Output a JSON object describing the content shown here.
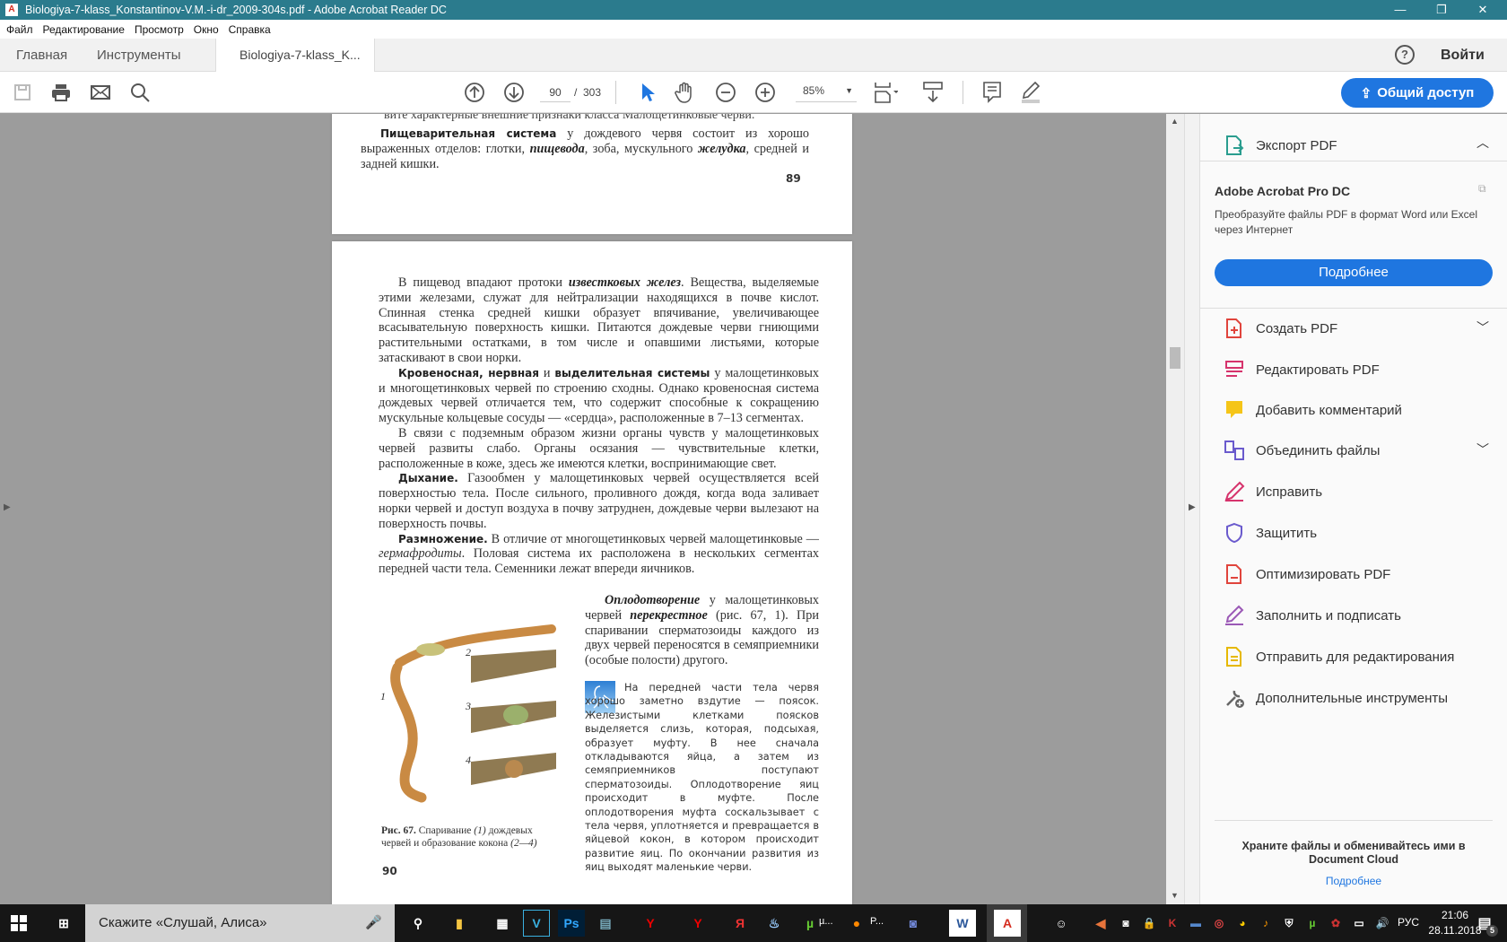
{
  "window": {
    "title": "Biologiya-7-klass_Konstantinov-V.M.-i-dr_2009-304s.pdf - Adobe Acrobat Reader DC",
    "minimize": "—",
    "maximize": "❐",
    "close": "✕"
  },
  "menu": [
    "Файл",
    "Редактирование",
    "Просмотр",
    "Окно",
    "Справка"
  ],
  "tabs": {
    "home": "Главная",
    "tools": "Инструменты",
    "doc": "Biologiya-7-klass_K...",
    "close": "×",
    "help": "?",
    "signin": "Войти"
  },
  "toolbar": {
    "page_current": "90",
    "page_sep": "/",
    "page_total": "303",
    "zoom": "85%",
    "share": "Общий доступ"
  },
  "page89": {
    "top_line": "вите характерные внешние признаки класса Малощетинковые черви.",
    "p1_bold": "Пищеварительная система",
    "p1_a": " у дождевого червя  состоит из хорошо выраженных отделов: глотки, ",
    "p1_b": "пищевода",
    "p1_c": ", зоба, мускульного ",
    "p1_d": "желудка",
    "p1_e": ", средней и задней кишки.",
    "number": "89"
  },
  "page90": {
    "p1_a": "В пищевод впадают протоки ",
    "p1_b": "известковых желез",
    "p1_c": ". Вещества, выделяемые этими железами, служат для нейтрализации находящихся в почве кислот. Спинная стенка средней кишки образует впячивание, увеличивающее всасывательную поверхность кишки. Питаются дождевые черви гниющими растительными остатками, в том числе и опавшими листьями, которые затаскивают в свои норки.",
    "p2_b1": "Кровеносная, нервная",
    "p2_a": " и ",
    "p2_b2": "выделительная системы",
    "p2_c": " у малощетинковых и многощетинковых червей по строению сходны. Однако кровеносная система дождевых червей отличается тем, что содержит способные к сокращению мускульные кольцевые сосуды — «сердца», расположенные в 7–13 сегментах.",
    "p3": "В связи с подземным образом жизни органы чувств у малощетинковых червей развиты слабо. Органы осязания — чувствительные клетки, расположенные в коже, здесь же имеются клетки, воспринимающие свет.",
    "p4_b": "Дыхание.",
    "p4_c": " Газообмен у малощетинковых червей осуществляется всей поверхностью тела. После сильного, проливного дождя, когда вода заливает норки червей и доступ воздуха в почву затруднен, дождевые черви вылезают на поверхность почвы.",
    "p5_b": "Размножение.",
    "p5_a": " В отличие от многощетинковых червей малощетинковые — ",
    "p5_i": "гермафродиты",
    "p5_c": ". Половая система их расположена в нескольких сегментах передней части тела. Семенники лежат впереди яичников.",
    "p6_b1": "Оплодотворение",
    "p6_a": " у малощетинковых червей ",
    "p6_b2": "перекрестное",
    "p6_c": " (рис. 67, 1). При спаривании сперматозоиды каждого из двух червей переносятся в семяприемники (особые полости) другого.",
    "box": "На передней части тела червя хорошо заметно вздутие — поясок. Железистыми клетками поясков выделяется слизь, которая, подсыхая, образует муфту. В нее сначала откладываются яйца, а затем из семяприемников поступают сперматозоиды. Оплодотворение яиц происходит в муфте. После оплодотворения муфта соскальзывает с тела червя, уплотняется и превращается в яйцевой кокон, в котором происходит развитие яиц. По окончании развития из яиц выходят маленькие черви.",
    "fig_labels": [
      "1",
      "2",
      "3",
      "4"
    ],
    "caption_b": "Рис. 67.",
    "caption_a": " Спаривание ",
    "caption_i1": "(1)",
    "caption_c": " дождевых червей и образование кокона ",
    "caption_i2": "(2—4)",
    "number": "90"
  },
  "panel": {
    "export": "Экспорт PDF",
    "product": "Adobe Acrobat Pro DC",
    "desc": "Преобразуйте файлы PDF в формат Word или Excel через Интернет",
    "more": "Подробнее",
    "tools": [
      "Создать PDF",
      "Редактировать PDF",
      "Добавить комментарий",
      "Объединить файлы",
      "Исправить",
      "Защитить",
      "Оптимизировать PDF",
      "Заполнить и подписать",
      "Отправить для редактирования",
      "Дополнительные инструменты"
    ],
    "cloud": "Храните файлы и обменивайтесь ими в Document Cloud",
    "cloud_more": "Подробнее"
  },
  "taskbar": {
    "search": "Скажите «Слушай, Алиса»",
    "app_utorrent": "µ...",
    "app_p": "P...",
    "lang": "РУС",
    "time": "21:06",
    "date": "28.11.2018",
    "notifications": "5"
  },
  "colors": {
    "titlebar": "#2b7b8d",
    "accent": "#1f76e0"
  }
}
